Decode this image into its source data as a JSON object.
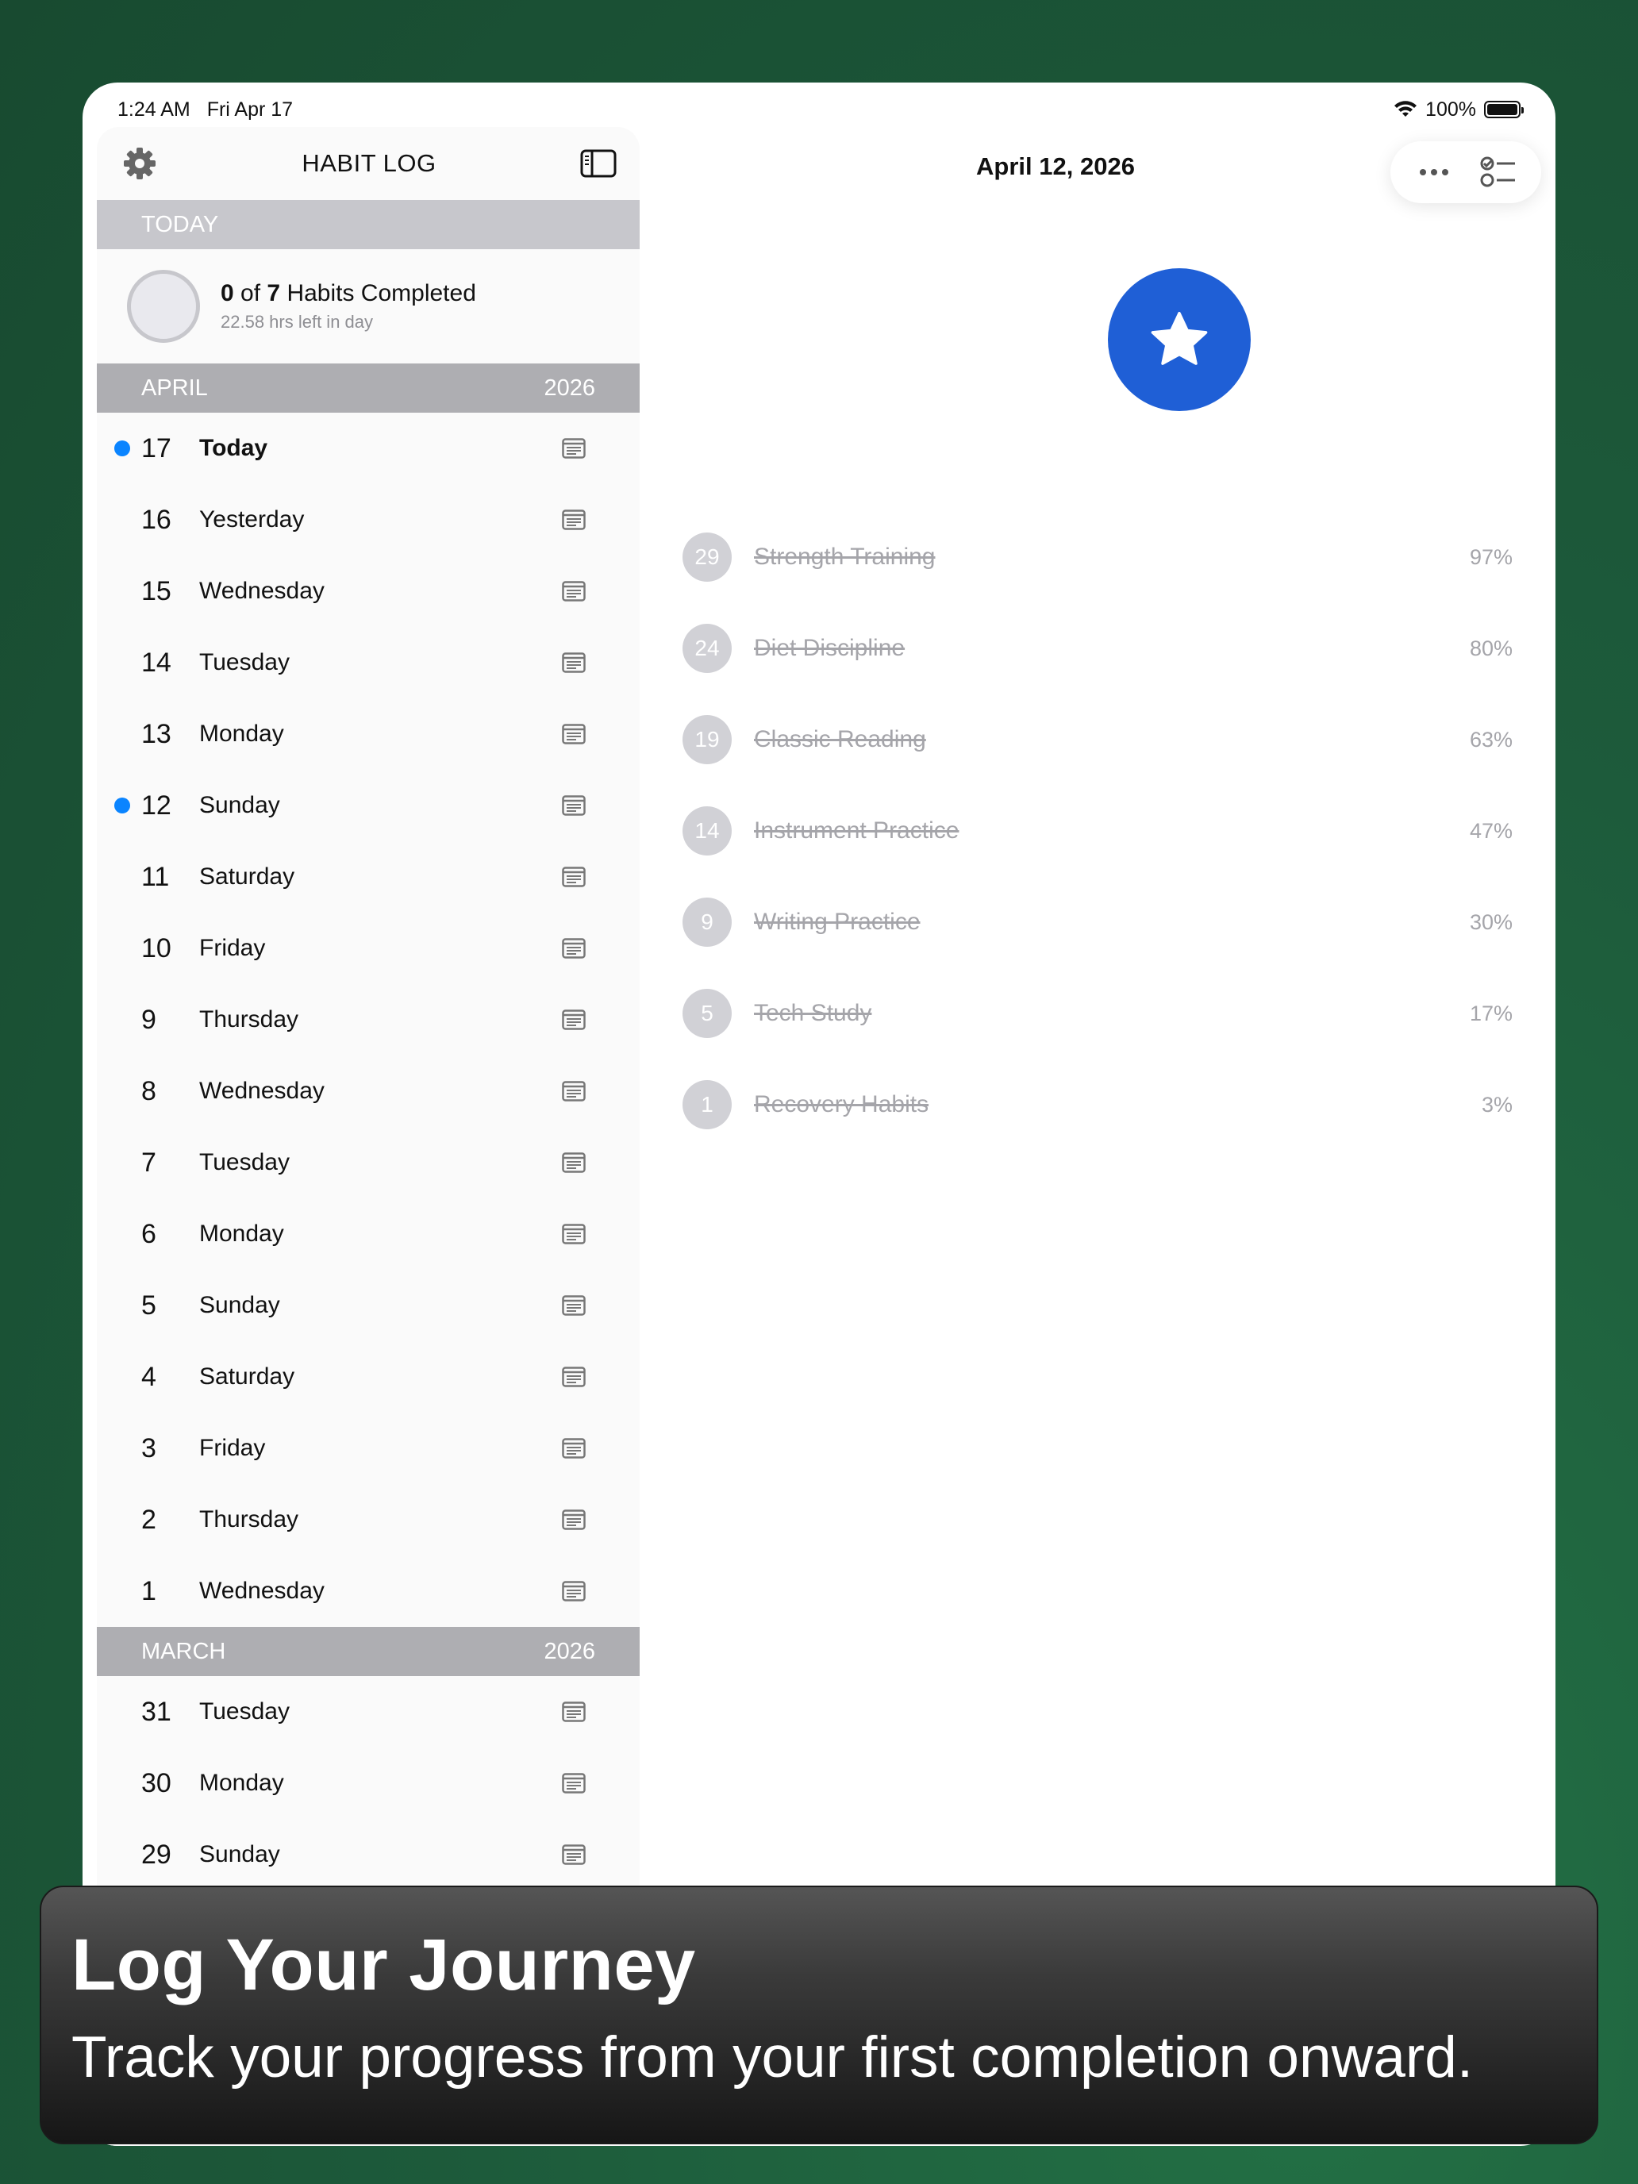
{
  "status": {
    "time": "1:24 AM",
    "date": "Fri Apr 17",
    "battery": "100%"
  },
  "sidebar": {
    "title": "HABIT LOG",
    "today_header": "TODAY",
    "today": {
      "done": "0",
      "of": "of",
      "total": "7",
      "label": "Habits Completed",
      "sub": "22.58 hrs left in day"
    },
    "april": {
      "month": "APRIL",
      "year": "2026"
    },
    "april_days": [
      {
        "num": "17",
        "name": "Today",
        "dot": true,
        "bold": true
      },
      {
        "num": "16",
        "name": "Yesterday"
      },
      {
        "num": "15",
        "name": "Wednesday"
      },
      {
        "num": "14",
        "name": "Tuesday"
      },
      {
        "num": "13",
        "name": "Monday"
      },
      {
        "num": "12",
        "name": "Sunday",
        "dot": true
      },
      {
        "num": "11",
        "name": "Saturday"
      },
      {
        "num": "10",
        "name": "Friday"
      },
      {
        "num": "9",
        "name": "Thursday"
      },
      {
        "num": "8",
        "name": "Wednesday"
      },
      {
        "num": "7",
        "name": "Tuesday"
      },
      {
        "num": "6",
        "name": "Monday"
      },
      {
        "num": "5",
        "name": "Sunday"
      },
      {
        "num": "4",
        "name": "Saturday"
      },
      {
        "num": "3",
        "name": "Friday"
      },
      {
        "num": "2",
        "name": "Thursday"
      },
      {
        "num": "1",
        "name": "Wednesday"
      }
    ],
    "march": {
      "month": "MARCH",
      "year": "2026"
    },
    "march_days": [
      {
        "num": "31",
        "name": "Tuesday"
      },
      {
        "num": "30",
        "name": "Monday"
      },
      {
        "num": "29",
        "name": "Sunday"
      }
    ]
  },
  "main": {
    "title": "April 12, 2026",
    "habits": [
      {
        "count": "29",
        "name": "Strength Training",
        "pct": "97%"
      },
      {
        "count": "24",
        "name": "Diet Discipline",
        "pct": "80%"
      },
      {
        "count": "19",
        "name": "Classic Reading",
        "pct": "63%"
      },
      {
        "count": "14",
        "name": "Instrument Practice",
        "pct": "47%"
      },
      {
        "count": "9",
        "name": "Writing Practice",
        "pct": "30%"
      },
      {
        "count": "5",
        "name": "Tech Study",
        "pct": "17%"
      },
      {
        "count": "1",
        "name": "Recovery Habits",
        "pct": "3%"
      }
    ]
  },
  "caption": {
    "title": "Log Your Journey",
    "subtitle": "Track your progress from your first completion onward."
  },
  "colors": {
    "accent": "#0a84ff",
    "badge": "#1f5fd6",
    "background": "#1d5b3b"
  }
}
